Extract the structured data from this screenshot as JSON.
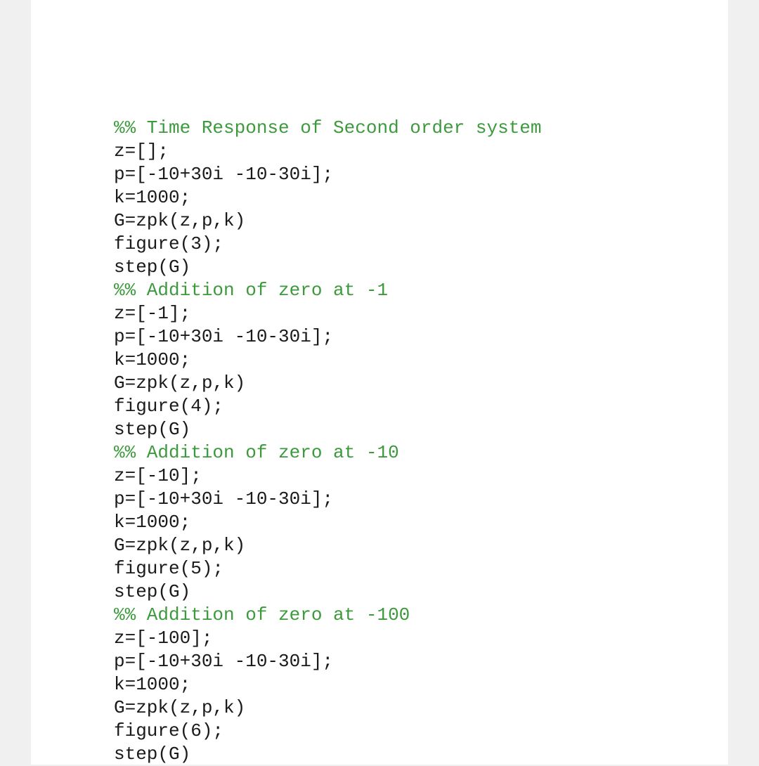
{
  "document": {
    "lines": [
      {
        "text": "%% Time Response of Second order system",
        "kind": "comment"
      },
      {
        "text": "z=[];",
        "kind": "code"
      },
      {
        "text": "p=[-10+30i -10-30i];",
        "kind": "code"
      },
      {
        "text": "k=1000;",
        "kind": "code"
      },
      {
        "text": "G=zpk(z,p,k)",
        "kind": "code"
      },
      {
        "text": "figure(3);",
        "kind": "code"
      },
      {
        "text": "step(G)",
        "kind": "code"
      },
      {
        "text": "%% Addition of zero at -1",
        "kind": "comment"
      },
      {
        "text": "z=[-1];",
        "kind": "code"
      },
      {
        "text": "p=[-10+30i -10-30i];",
        "kind": "code"
      },
      {
        "text": "k=1000;",
        "kind": "code"
      },
      {
        "text": "G=zpk(z,p,k)",
        "kind": "code"
      },
      {
        "text": "figure(4);",
        "kind": "code"
      },
      {
        "text": "step(G)",
        "kind": "code"
      },
      {
        "text": "%% Addition of zero at -10",
        "kind": "comment"
      },
      {
        "text": "z=[-10];",
        "kind": "code"
      },
      {
        "text": "p=[-10+30i -10-30i];",
        "kind": "code"
      },
      {
        "text": "k=1000;",
        "kind": "code"
      },
      {
        "text": "G=zpk(z,p,k)",
        "kind": "code"
      },
      {
        "text": "figure(5);",
        "kind": "code"
      },
      {
        "text": "step(G)",
        "kind": "code"
      },
      {
        "text": "%% Addition of zero at -100",
        "kind": "comment"
      },
      {
        "text": "z=[-100];",
        "kind": "code"
      },
      {
        "text": "p=[-10+30i -10-30i];",
        "kind": "code"
      },
      {
        "text": "k=1000;",
        "kind": "code"
      },
      {
        "text": "G=zpk(z,p,k)",
        "kind": "code"
      },
      {
        "text": "figure(6);",
        "kind": "code"
      },
      {
        "text": "step(G)",
        "kind": "code"
      }
    ]
  },
  "colors": {
    "comment": "#3c9a3c",
    "code": "#1a1a1a",
    "page": "#ffffff",
    "margin": "#f0f0f0"
  }
}
